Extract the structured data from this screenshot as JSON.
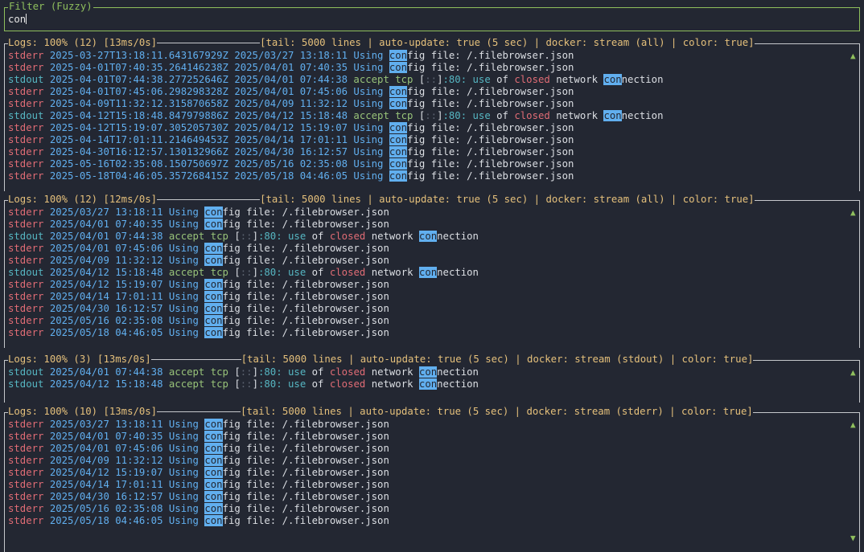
{
  "filter": {
    "title": "Filter (Fuzzy)",
    "value": "con"
  },
  "highlight_term": "con",
  "panels": [
    {
      "stats": "Logs: 100% (12) [13ms/0s]",
      "info": "[tail: 5000 lines | auto-update: true (5 sec) | docker: stream (all) | color: true]",
      "show_docker_ts": true,
      "rows": [
        {
          "stream": "stderr",
          "docker_ts": "2025-03-27T13:18:11.643167929Z",
          "date": "2025/03/27",
          "time": "13:18:11",
          "kind": "config",
          "file": "/.filebrowser.json"
        },
        {
          "stream": "stderr",
          "docker_ts": "2025-04-01T07:40:35.264146238Z",
          "date": "2025/04/01",
          "time": "07:40:35",
          "kind": "config",
          "file": "/.filebrowser.json"
        },
        {
          "stream": "stdout",
          "docker_ts": "2025-04-01T07:44:38.277252646Z",
          "date": "2025/04/01",
          "time": "07:44:38",
          "kind": "accept",
          "addr": "[::]:80:"
        },
        {
          "stream": "stderr",
          "docker_ts": "2025-04-01T07:45:06.298298328Z",
          "date": "2025/04/01",
          "time": "07:45:06",
          "kind": "config",
          "file": "/.filebrowser.json"
        },
        {
          "stream": "stderr",
          "docker_ts": "2025-04-09T11:32:12.315870658Z",
          "date": "2025/04/09",
          "time": "11:32:12",
          "kind": "config",
          "file": "/.filebrowser.json"
        },
        {
          "stream": "stdout",
          "docker_ts": "2025-04-12T15:18:48.847979886Z",
          "date": "2025/04/12",
          "time": "15:18:48",
          "kind": "accept",
          "addr": "[::]:80:"
        },
        {
          "stream": "stderr",
          "docker_ts": "2025-04-12T15:19:07.305205730Z",
          "date": "2025/04/12",
          "time": "15:19:07",
          "kind": "config",
          "file": "/.filebrowser.json"
        },
        {
          "stream": "stderr",
          "docker_ts": "2025-04-14T17:01:11.214649453Z",
          "date": "2025/04/14",
          "time": "17:01:11",
          "kind": "config",
          "file": "/.filebrowser.json"
        },
        {
          "stream": "stderr",
          "docker_ts": "2025-04-30T16:12:57.130132966Z",
          "date": "2025/04/30",
          "time": "16:12:57",
          "kind": "config",
          "file": "/.filebrowser.json"
        },
        {
          "stream": "stderr",
          "docker_ts": "2025-05-16T02:35:08.150750697Z",
          "date": "2025/05/16",
          "time": "02:35:08",
          "kind": "config",
          "file": "/.filebrowser.json"
        },
        {
          "stream": "stderr",
          "docker_ts": "2025-05-18T04:46:05.357268415Z",
          "date": "2025/05/18",
          "time": "04:46:05",
          "kind": "config",
          "file": "/.filebrowser.json"
        }
      ]
    },
    {
      "stats": "Logs: 100% (12) [12ms/0s]",
      "info": "[tail: 5000 lines | auto-update: true (5 sec) | docker: stream (all) | color: true]",
      "show_docker_ts": false,
      "rows": [
        {
          "stream": "stderr",
          "date": "2025/03/27",
          "time": "13:18:11",
          "kind": "config",
          "file": "/.filebrowser.json"
        },
        {
          "stream": "stderr",
          "date": "2025/04/01",
          "time": "07:40:35",
          "kind": "config",
          "file": "/.filebrowser.json"
        },
        {
          "stream": "stdout",
          "date": "2025/04/01",
          "time": "07:44:38",
          "kind": "accept",
          "addr": "[::]:80:"
        },
        {
          "stream": "stderr",
          "date": "2025/04/01",
          "time": "07:45:06",
          "kind": "config",
          "file": "/.filebrowser.json"
        },
        {
          "stream": "stderr",
          "date": "2025/04/09",
          "time": "11:32:12",
          "kind": "config",
          "file": "/.filebrowser.json"
        },
        {
          "stream": "stdout",
          "date": "2025/04/12",
          "time": "15:18:48",
          "kind": "accept",
          "addr": "[::]:80:"
        },
        {
          "stream": "stderr",
          "date": "2025/04/12",
          "time": "15:19:07",
          "kind": "config",
          "file": "/.filebrowser.json"
        },
        {
          "stream": "stderr",
          "date": "2025/04/14",
          "time": "17:01:11",
          "kind": "config",
          "file": "/.filebrowser.json"
        },
        {
          "stream": "stderr",
          "date": "2025/04/30",
          "time": "16:12:57",
          "kind": "config",
          "file": "/.filebrowser.json"
        },
        {
          "stream": "stderr",
          "date": "2025/05/16",
          "time": "02:35:08",
          "kind": "config",
          "file": "/.filebrowser.json"
        },
        {
          "stream": "stderr",
          "date": "2025/05/18",
          "time": "04:46:05",
          "kind": "config",
          "file": "/.filebrowser.json"
        }
      ]
    },
    {
      "stats": "Logs: 100% (3) [13ms/0s]",
      "info": "[tail: 5000 lines | auto-update: true (5 sec) | docker: stream (stdout) | color: true]",
      "show_docker_ts": false,
      "rows": [
        {
          "stream": "stdout",
          "date": "2025/04/01",
          "time": "07:44:38",
          "kind": "accept",
          "addr": "[::]:80:"
        },
        {
          "stream": "stdout",
          "date": "2025/04/12",
          "time": "15:18:48",
          "kind": "accept",
          "addr": "[::]:80:"
        }
      ]
    },
    {
      "stats": "Logs: 100% (10) [13ms/0s]",
      "info": "[tail: 5000 lines | auto-update: true (5 sec) | docker: stream (stderr) | color: true]",
      "show_docker_ts": false,
      "rows": [
        {
          "stream": "stderr",
          "date": "2025/03/27",
          "time": "13:18:11",
          "kind": "config",
          "file": "/.filebrowser.json"
        },
        {
          "stream": "stderr",
          "date": "2025/04/01",
          "time": "07:40:35",
          "kind": "config",
          "file": "/.filebrowser.json"
        },
        {
          "stream": "stderr",
          "date": "2025/04/01",
          "time": "07:45:06",
          "kind": "config",
          "file": "/.filebrowser.json"
        },
        {
          "stream": "stderr",
          "date": "2025/04/09",
          "time": "11:32:12",
          "kind": "config",
          "file": "/.filebrowser.json"
        },
        {
          "stream": "stderr",
          "date": "2025/04/12",
          "time": "15:19:07",
          "kind": "config",
          "file": "/.filebrowser.json"
        },
        {
          "stream": "stderr",
          "date": "2025/04/14",
          "time": "17:01:11",
          "kind": "config",
          "file": "/.filebrowser.json"
        },
        {
          "stream": "stderr",
          "date": "2025/04/30",
          "time": "16:12:57",
          "kind": "config",
          "file": "/.filebrowser.json"
        },
        {
          "stream": "stderr",
          "date": "2025/05/16",
          "time": "02:35:08",
          "kind": "config",
          "file": "/.filebrowser.json"
        },
        {
          "stream": "stderr",
          "date": "2025/05/18",
          "time": "04:46:05",
          "kind": "config",
          "file": "/.filebrowser.json"
        }
      ]
    }
  ],
  "words": {
    "using": "Using",
    "config_rest": "fig file:",
    "accept": "accept tcp",
    "use_of": "use",
    "of": "of",
    "closed": "closed",
    "network": "network",
    "connection_rest": "nection"
  },
  "colors": {
    "accent": "#8fbf5d",
    "title": "#e5c07b",
    "stderr": "#e06c75",
    "stdout": "#56b6c2",
    "timestamp": "#61afef",
    "highlight": "#61afef"
  },
  "icons": {
    "scroll_up": "▲",
    "scroll_down": "▼"
  }
}
